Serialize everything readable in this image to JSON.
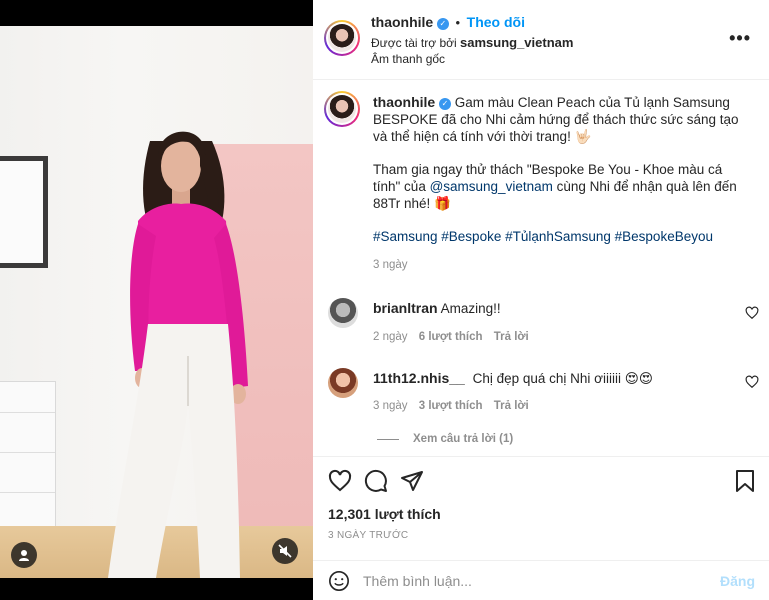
{
  "post": {
    "author": "thaonhile",
    "follow_label": "Theo dõi",
    "sponsored_prefix": "Được tài trợ bởi",
    "sponsor": "samsung_vietnam",
    "audio": "Âm thanh gốc",
    "more_label": "•••"
  },
  "caption": {
    "author": "thaonhile",
    "line1": "Gam màu Clean Peach của Tủ lạnh Samsung BESPOKE đã cho Nhi cảm hứng để thách thức sức sáng tạo và thể hiện cá tính với thời trang! 🤟🏻",
    "line2a": "Tham gia ngay thử thách \"Bespoke Be You - Khoe màu cá tính\" của ",
    "mention": "@samsung_vietnam",
    "line2b": " cùng Nhi để nhận quà lên đến 88Tr nhé! 🎁",
    "hashtags": "#Samsung #Bespoke #TủlạnhSamsung #BespokeBeyou",
    "time": "3 ngày"
  },
  "comments": [
    {
      "user": "brianltran",
      "text": "Amazing!!",
      "time": "2 ngày",
      "likes": "6 lượt thích",
      "reply": "Trả lời"
    },
    {
      "user": "11th12.nhis__",
      "text": "Chị đẹp quá chị Nhi ơiiiiii 😍😍",
      "time": "3 ngày",
      "likes": "3 lượt thích",
      "reply": "Trả lời"
    }
  ],
  "view_replies": "Xem câu trả lời (1)",
  "likes_count": "12,301 lượt thích",
  "date": "3 NGÀY TRƯỚC",
  "add_comment": {
    "placeholder": "Thêm bình luận...",
    "post_label": "Đăng"
  },
  "icons": [
    "heart-icon",
    "comment-icon",
    "share-icon",
    "bookmark-icon",
    "emoji-icon",
    "user-tag-icon",
    "mute-icon",
    "more-icon",
    "verified-icon"
  ],
  "colors": {
    "accent": "#0095f6",
    "verified": "#3897f0",
    "link": "#00376b",
    "muted": "#8e8e8e"
  }
}
